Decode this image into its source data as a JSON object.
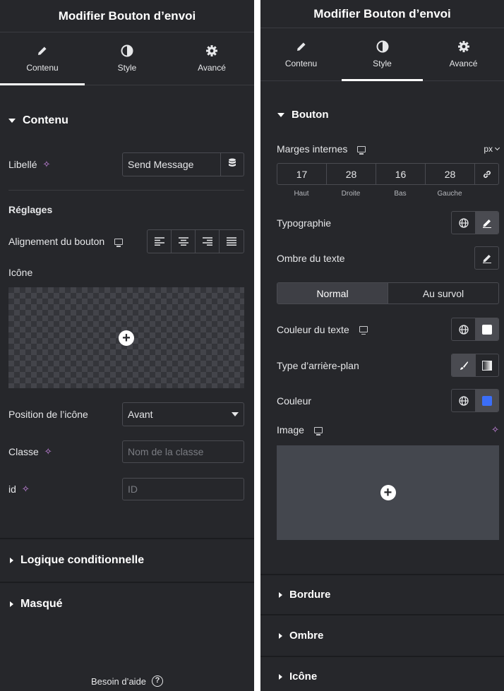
{
  "left_panel": {
    "title": "Modifier Bouton d’envoi",
    "tabs": [
      {
        "label": "Contenu",
        "icon": "pencil-icon",
        "active": true
      },
      {
        "label": "Style",
        "icon": "contrast-icon",
        "active": false
      },
      {
        "label": "Avancé",
        "icon": "gear-icon",
        "active": false
      }
    ],
    "section_content": "Contenu",
    "libelle_label": "Libellé",
    "libelle_value": "Send Message",
    "reglages_label": "Réglages",
    "alignment_label": "Alignement du bouton",
    "icone_label": "Icône",
    "icon_position_label": "Position de l’icône",
    "icon_position_value": "Avant",
    "classe_label": "Classe",
    "classe_placeholder": "Nom de la classe",
    "id_label": "id",
    "id_placeholder": "ID",
    "section_logic": "Logique conditionnelle",
    "section_masque": "Masqué",
    "help_text": "Besoin d’aide",
    "help_symbol": "?"
  },
  "right_panel": {
    "title": "Modifier Bouton d’envoi",
    "tabs": [
      {
        "label": "Contenu",
        "icon": "pencil-icon",
        "active": false
      },
      {
        "label": "Style",
        "icon": "contrast-icon",
        "active": true
      },
      {
        "label": "Avancé",
        "icon": "gear-icon",
        "active": false
      }
    ],
    "section_bouton": "Bouton",
    "padding_label": "Marges internes",
    "unit": "px",
    "padding": {
      "top": "17",
      "right": "28",
      "bottom": "16",
      "left": "28"
    },
    "padding_labels": {
      "top": "Haut",
      "right": "Droite",
      "bottom": "Bas",
      "left": "Gauche"
    },
    "typography_label": "Typographie",
    "text_shadow_label": "Ombre du texte",
    "state_normal": "Normal",
    "state_hover": "Au survol",
    "text_color_label": "Couleur du texte",
    "bg_type_label": "Type d’arrière-plan",
    "color_label": "Couleur",
    "image_label": "Image",
    "section_bordure": "Bordure",
    "section_ombre": "Ombre",
    "section_icone": "Icône"
  },
  "colors": {
    "panel_bg": "#26272b",
    "text_color_swatch": "#ffffff",
    "button_color_swatch": "#3b6ef8",
    "ai_accent": "#d58df0"
  }
}
